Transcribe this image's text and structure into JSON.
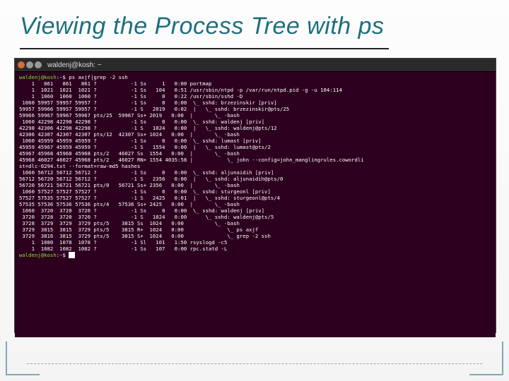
{
  "slide": {
    "title": "Viewing the Process Tree with ps"
  },
  "terminal": {
    "title_prefix": "✕ ▣ ",
    "title": "waldenj@kosh: ~",
    "prompt_user_host": "waldenj@kosh",
    "prompt_cwd": "~",
    "command": "ps axjf|grep -2 ssh",
    "lines": [
      "    1   861   861   861 ?           -1 Ss     1   0:00 portmap",
      "    1  1021  1021  1021 ?           -1 Ss   104   0:51 /usr/sbin/ntpd -p /var/run/ntpd.pid -g -u 104:114",
      "    1  1060  1060  1060 ?           -1 Ss     0   0:22 /usr/sbin/sshd -D",
      " 1060 59957 59957 59957 ?           -1 Ss     0   0:00  \\_ sshd: brzezinskir [priv]",
      "59957 59966 59957 59957 ?           -1 S   2019   0:02  |   \\_ sshd: brzezinskir@pts/25",
      "59966 59967 59967 59967 pts/25  59967 Ss+ 2019   0:00  |       \\_ -bash",
      " 1060 42298 42298 42298 ?           -1 Ss     0   0:00  \\_ sshd: waldenj [priv]",
      "42298 42306 42298 42298 ?           -1 S   1024   0:00  |   \\_ sshd: waldenj@pts/12",
      "42306 42307 42307 42307 pts/12  42307 Ss+ 1024   0:00  |       \\_ -bash",
      " 1060 45959 45959 45959 ?           -1 Ss     0   0:00  \\_ sshd: lumast [priv]",
      "45959 45967 45959 45959 ?           -1 S   1554   0:00  |   \\_ sshd: lumast@pts/2",
      "45967 45968 45968 45968 pts/2   46027 Ss  1554   0:00  |       \\_ -bash",
      "45968 46027 46027 45968 pts/2   46027 RN+ 1554 4035:58 |           \\_ john --config=john_manglingrules.cowordli",
      "st=dlc-0294.txt --format=raw-md5 hashes",
      " 1060 56712 56712 56712 ?           -1 Ss     0   0:00  \\_ sshd: aljunaidih [priv]",
      "56712 56720 56712 56712 ?           -1 S   2356   0:00  |   \\_ sshd: aljunaidih@pts/0",
      "56720 56721 56721 56721 pts/0   56721 Ss+ 2356   0:00  |       \\_ -bash",
      " 1060 57527 57527 57527 ?           -1 Ss     0   0:00  \\_ sshd: sturgeonl [priv]",
      "57527 57535 57527 57527 ?           -1 S   2425   0:01  |   \\_ sshd: sturgeonl@pts/4",
      "57535 57536 57536 57536 pts/4   57536 Ss+ 2425   0:00  |       \\_ -bash",
      " 1060  3720  3720  3720 ?           -1 Ss     0   0:00  \\_ sshd: waldenj [priv]",
      " 3720  3728  3720  3720 ?           -1 S   1024   0:00      \\_ sshd: waldenj@pts/5",
      " 3728  3729  3729  3729 pts/5    3815 Ss  1024   0:00          \\_ -bash",
      " 3729  3815  3815  3729 pts/5    3815 R+  1024   0:00              \\_ ps axjf",
      " 3729  3816  3815  3729 pts/5    3815 S+  1024   0:00              \\_ grep -2 ssh",
      "    1  1080  1078  1078 ?           -1 Sl   101   1:50 rsyslogd -c5",
      "    1  1082  1082  1082 ?           -1 Ss   107   0:00 rpc.statd -L"
    ],
    "final_prompt": true
  }
}
